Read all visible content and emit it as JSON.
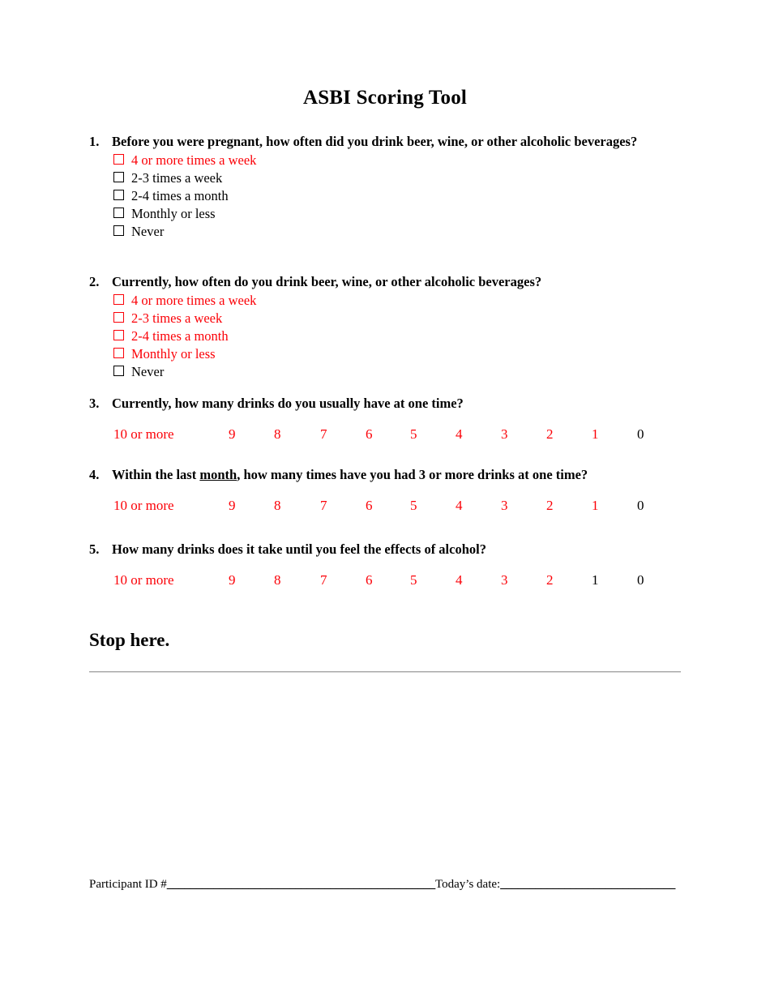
{
  "document": {
    "title": "ASBI Scoring Tool",
    "stop_notice": "Stop here.",
    "colors": {
      "scored_red": "#fb0007",
      "text_black": "#000000",
      "rule_gray": "#a8a8a8",
      "page_background": "#ffffff"
    }
  },
  "questions": [
    {
      "number": "1.",
      "stem_parts": [
        {
          "text": "Before you were pregnant, how often did you drink beer, wine, or other alcoholic beverages?",
          "underline": false
        }
      ],
      "stem_plain": "Before you were pregnant, how often did you drink beer, wine, or other alcoholic beverages?",
      "type": "checkbox-list",
      "options": [
        {
          "label": "4 or more times a week",
          "color": "red"
        },
        {
          "label": "2-3 times a week",
          "color": "black"
        },
        {
          "label": "2-4 times a month",
          "color": "black"
        },
        {
          "label": "Monthly or less",
          "color": "black"
        },
        {
          "label": "Never",
          "color": "black"
        }
      ]
    },
    {
      "number": "2.",
      "stem_parts": [
        {
          "text": "Currently, how often do you drink beer, wine, or other alcoholic beverages?",
          "underline": false
        }
      ],
      "stem_plain": "Currently, how often do you drink beer, wine, or other alcoholic beverages?",
      "type": "checkbox-list",
      "options": [
        {
          "label": "4 or more times a week",
          "color": "red"
        },
        {
          "label": "2-3 times a week",
          "color": "red"
        },
        {
          "label": "2-4 times a month",
          "color": "red"
        },
        {
          "label": "Monthly or less",
          "color": "red"
        },
        {
          "label": "Never",
          "color": "black"
        }
      ]
    },
    {
      "number": "3.",
      "stem_parts": [
        {
          "text": "Currently, how many drinks do you usually have at one time?",
          "underline": false
        }
      ],
      "stem_plain": "Currently, how many drinks do you usually have at one time?",
      "type": "numeric-scale",
      "scale": [
        {
          "label": "10 or more",
          "color": "red"
        },
        {
          "label": "9",
          "color": "red"
        },
        {
          "label": "8",
          "color": "red"
        },
        {
          "label": "7",
          "color": "red"
        },
        {
          "label": "6",
          "color": "red"
        },
        {
          "label": "5",
          "color": "red"
        },
        {
          "label": "4",
          "color": "red"
        },
        {
          "label": "3",
          "color": "red"
        },
        {
          "label": "2",
          "color": "red"
        },
        {
          "label": "1",
          "color": "red"
        },
        {
          "label": "0",
          "color": "black"
        }
      ]
    },
    {
      "number": "4.",
      "stem_parts": [
        {
          "text": "Within the last ",
          "underline": false
        },
        {
          "text": "month",
          "underline": true
        },
        {
          "text": ", how many times have you had 3 or more drinks at one time?",
          "underline": false
        }
      ],
      "stem_plain": "Within the last month, how many times have you had 3 or more drinks at one time?",
      "type": "numeric-scale",
      "scale": [
        {
          "label": "10 or more",
          "color": "red"
        },
        {
          "label": "9",
          "color": "red"
        },
        {
          "label": "8",
          "color": "red"
        },
        {
          "label": "7",
          "color": "red"
        },
        {
          "label": "6",
          "color": "red"
        },
        {
          "label": "5",
          "color": "red"
        },
        {
          "label": "4",
          "color": "red"
        },
        {
          "label": "3",
          "color": "red"
        },
        {
          "label": "2",
          "color": "red"
        },
        {
          "label": "1",
          "color": "red"
        },
        {
          "label": "0",
          "color": "black"
        }
      ]
    },
    {
      "number": "5.",
      "stem_parts": [
        {
          "text": "How many drinks does it take until you feel the effects of alcohol?",
          "underline": false
        }
      ],
      "stem_plain": "How many drinks does it take until you feel the effects of alcohol?",
      "type": "numeric-scale",
      "scale": [
        {
          "label": "10 or more",
          "color": "red"
        },
        {
          "label": "9",
          "color": "red"
        },
        {
          "label": "8",
          "color": "red"
        },
        {
          "label": "7",
          "color": "red"
        },
        {
          "label": "6",
          "color": "red"
        },
        {
          "label": "5",
          "color": "red"
        },
        {
          "label": "4",
          "color": "red"
        },
        {
          "label": "3",
          "color": "red"
        },
        {
          "label": "2",
          "color": "red"
        },
        {
          "label": "1",
          "color": "black"
        },
        {
          "label": "0",
          "color": "black"
        }
      ]
    }
  ],
  "footer": {
    "participant_label": "Participant ID #",
    "participant_value": "",
    "participant_rule": "______________________________________________",
    "date_label": "Today’s date:",
    "date_value": "",
    "date_rule": "______________________________"
  }
}
